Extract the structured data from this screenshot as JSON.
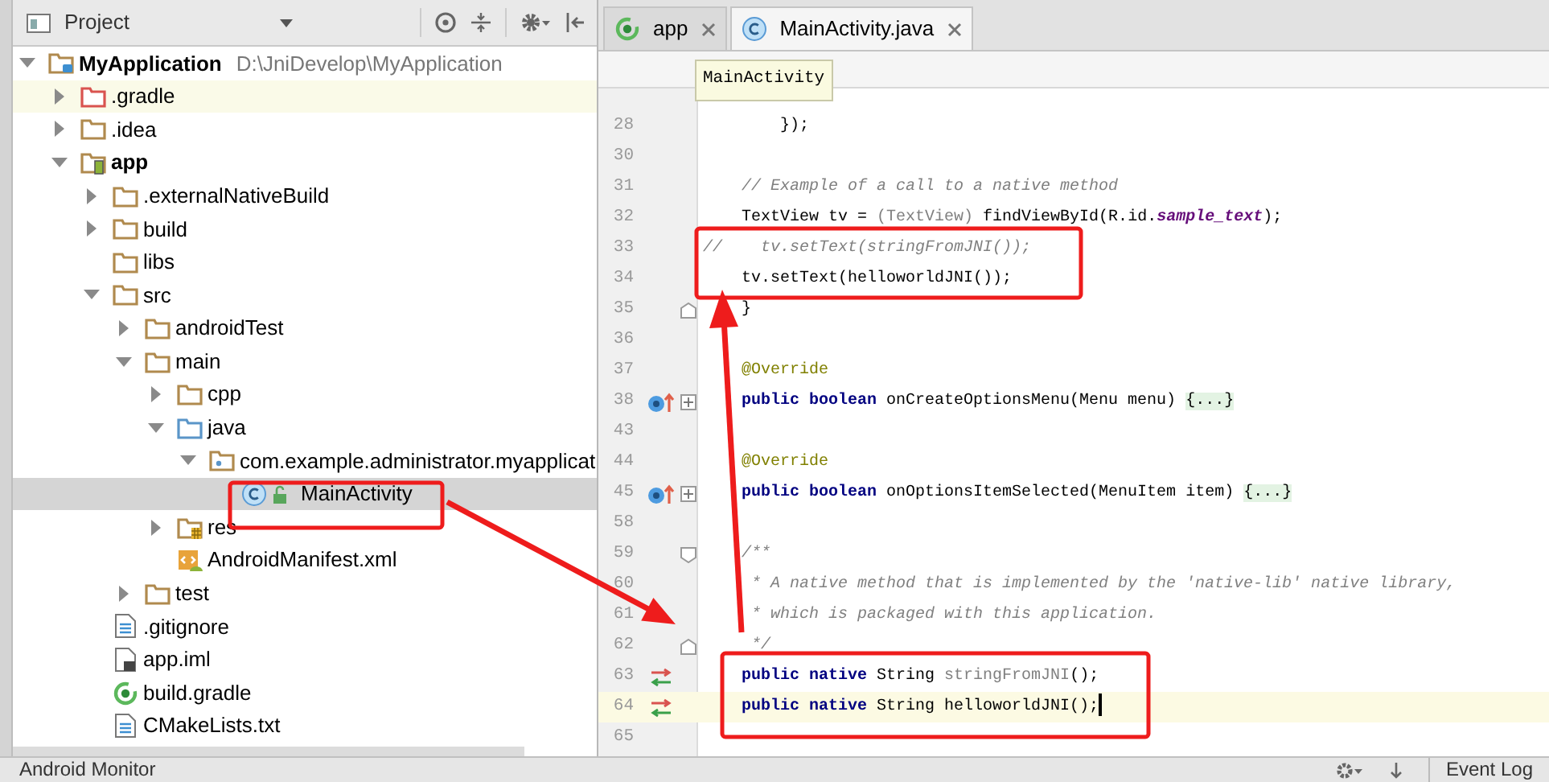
{
  "project_panel": {
    "title": "Project",
    "tree": [
      {
        "label": "MyApplication",
        "path": "D:\\JniDevelop\\MyApplication",
        "kind": "project-folder",
        "bold": true,
        "expanded": true,
        "selected": false,
        "hovered": false,
        "children": [
          {
            "label": ".gradle",
            "kind": "excluded-folder",
            "bold": false,
            "expanded": false,
            "selected": false,
            "hovered": true
          },
          {
            "label": ".idea",
            "kind": "folder",
            "bold": false,
            "expanded": false,
            "selected": false,
            "hovered": false
          },
          {
            "label": "app",
            "kind": "module-folder",
            "bold": true,
            "expanded": true,
            "selected": false,
            "hovered": false,
            "children": [
              {
                "label": ".externalNativeBuild",
                "kind": "folder",
                "bold": false,
                "expanded": false,
                "selected": false,
                "hovered": false
              },
              {
                "label": "build",
                "kind": "folder",
                "bold": false,
                "expanded": false,
                "selected": false,
                "hovered": false
              },
              {
                "label": "libs",
                "kind": "folder",
                "bold": false,
                "selected": false,
                "hovered": false
              },
              {
                "label": "src",
                "kind": "folder",
                "bold": false,
                "expanded": true,
                "selected": false,
                "hovered": false,
                "children": [
                  {
                    "label": "androidTest",
                    "kind": "folder",
                    "bold": false,
                    "expanded": false,
                    "selected": false,
                    "hovered": false
                  },
                  {
                    "label": "main",
                    "kind": "folder",
                    "bold": false,
                    "expanded": true,
                    "selected": false,
                    "hovered": false,
                    "children": [
                      {
                        "label": "cpp",
                        "kind": "folder",
                        "bold": false,
                        "expanded": false,
                        "selected": false,
                        "hovered": false
                      },
                      {
                        "label": "java",
                        "kind": "source-folder",
                        "bold": false,
                        "expanded": true,
                        "selected": false,
                        "hovered": false,
                        "children": [
                          {
                            "label": "com.example.administrator.myapplicat",
                            "kind": "package",
                            "bold": false,
                            "expanded": true,
                            "selected": false,
                            "hovered": false,
                            "children": [
                              {
                                "label": "MainActivity",
                                "kind": "class",
                                "bold": false,
                                "selected": true,
                                "hovered": false
                              }
                            ]
                          }
                        ]
                      },
                      {
                        "label": "res",
                        "kind": "resource-folder",
                        "bold": false,
                        "expanded": false,
                        "selected": false,
                        "hovered": false
                      },
                      {
                        "label": "AndroidManifest.xml",
                        "kind": "manifest",
                        "bold": false,
                        "selected": false,
                        "hovered": false
                      }
                    ]
                  },
                  {
                    "label": "test",
                    "kind": "folder",
                    "bold": false,
                    "expanded": false,
                    "selected": false,
                    "hovered": false
                  }
                ]
              },
              {
                "label": ".gitignore",
                "kind": "text-file",
                "bold": false,
                "selected": false,
                "hovered": false
              },
              {
                "label": "app.iml",
                "kind": "iml-file",
                "bold": false,
                "selected": false,
                "hovered": false
              },
              {
                "label": "build.gradle",
                "kind": "gradle-file",
                "bold": false,
                "selected": false,
                "hovered": false
              },
              {
                "label": "CMakeLists.txt",
                "kind": "text-file",
                "bold": false,
                "selected": false,
                "hovered": false
              }
            ]
          }
        ]
      }
    ]
  },
  "editor": {
    "tabs": [
      {
        "label": "app",
        "kind": "gradle-file",
        "selected": false
      },
      {
        "label": "MainActivity.java",
        "kind": "class",
        "selected": true
      }
    ],
    "breadcrumb_tooltip": "MainActivity",
    "lines": [
      {
        "number": "28",
        "current": false,
        "code": [
          {
            "text": "        });",
            "kind": "plain"
          }
        ]
      },
      {
        "number": "30",
        "current": false
      },
      {
        "number": "31",
        "current": false,
        "code": [
          {
            "text": "    // Example of a call to a native method",
            "kind": "comment"
          }
        ]
      },
      {
        "number": "32",
        "current": false,
        "code": [
          {
            "text": "    TextView tv = ",
            "kind": "plain"
          },
          {
            "text": "(TextView)",
            "kind": "unused"
          },
          {
            "text": " findViewById(R.id.",
            "kind": "plain"
          },
          {
            "text": "sample_text",
            "kind": "field"
          },
          {
            "text": ");",
            "kind": "plain"
          }
        ]
      },
      {
        "number": "33",
        "current": false,
        "code": [
          {
            "text": "//    tv.setText(stringFromJNI());",
            "kind": "comment"
          }
        ]
      },
      {
        "number": "34",
        "current": false,
        "code": [
          {
            "text": "    tv.setText(helloworldJNI());",
            "kind": "plain"
          }
        ]
      },
      {
        "number": "35",
        "current": false,
        "fold": {
          "kind": "end"
        },
        "code": [
          {
            "text": "    }",
            "kind": "plain"
          }
        ]
      },
      {
        "number": "36",
        "current": false
      },
      {
        "number": "37",
        "current": false,
        "code": [
          {
            "text": "    @Override",
            "kind": "annotation"
          }
        ]
      },
      {
        "number": "38",
        "current": false,
        "gutter": {
          "kind": "override"
        },
        "fold": {
          "kind": "collapsed"
        },
        "code": [
          {
            "text": "    public boolean",
            "kind": "keyword"
          },
          {
            "text": " onCreateOptionsMenu(Menu menu) ",
            "kind": "plain"
          },
          {
            "text": "{...}",
            "kind": "folded"
          }
        ]
      },
      {
        "number": "43",
        "current": false
      },
      {
        "number": "44",
        "current": false,
        "code": [
          {
            "text": "    @Override",
            "kind": "annotation"
          }
        ]
      },
      {
        "number": "45",
        "current": false,
        "gutter": {
          "kind": "override"
        },
        "fold": {
          "kind": "collapsed"
        },
        "code": [
          {
            "text": "    public boolean",
            "kind": "keyword"
          },
          {
            "text": " onOptionsItemSelected(MenuItem item) ",
            "kind": "plain"
          },
          {
            "text": "{...}",
            "kind": "folded"
          }
        ]
      },
      {
        "number": "58",
        "current": false
      },
      {
        "number": "59",
        "current": false,
        "fold": {
          "kind": "start"
        },
        "code": [
          {
            "text": "    /**",
            "kind": "comment"
          }
        ]
      },
      {
        "number": "60",
        "current": false,
        "code": [
          {
            "text": "     * A native method that is implemented by the 'native-lib' native library,",
            "kind": "comment"
          }
        ]
      },
      {
        "number": "61",
        "current": false,
        "code": [
          {
            "text": "     * which is packaged with this application.",
            "kind": "comment"
          }
        ]
      },
      {
        "number": "62",
        "current": false,
        "fold": {
          "kind": "end"
        },
        "code": [
          {
            "text": "     */",
            "kind": "comment"
          }
        ]
      },
      {
        "number": "63",
        "current": false,
        "gutter": {
          "kind": "native"
        },
        "code": [
          {
            "text": "    public native",
            "kind": "keyword"
          },
          {
            "text": " String ",
            "kind": "plain"
          },
          {
            "text": "stringFromJNI",
            "kind": "unused"
          },
          {
            "text": "();",
            "kind": "plain"
          }
        ]
      },
      {
        "number": "64",
        "current": true,
        "gutter": {
          "kind": "native"
        },
        "code": [
          {
            "text": "    public native",
            "kind": "keyword"
          },
          {
            "text": " String helloworldJNI();",
            "kind": "plain"
          }
        ]
      },
      {
        "number": "65",
        "current": false
      }
    ]
  },
  "bottom_bar": {
    "left_title": "Android Monitor",
    "right_title": "Event Log"
  }
}
